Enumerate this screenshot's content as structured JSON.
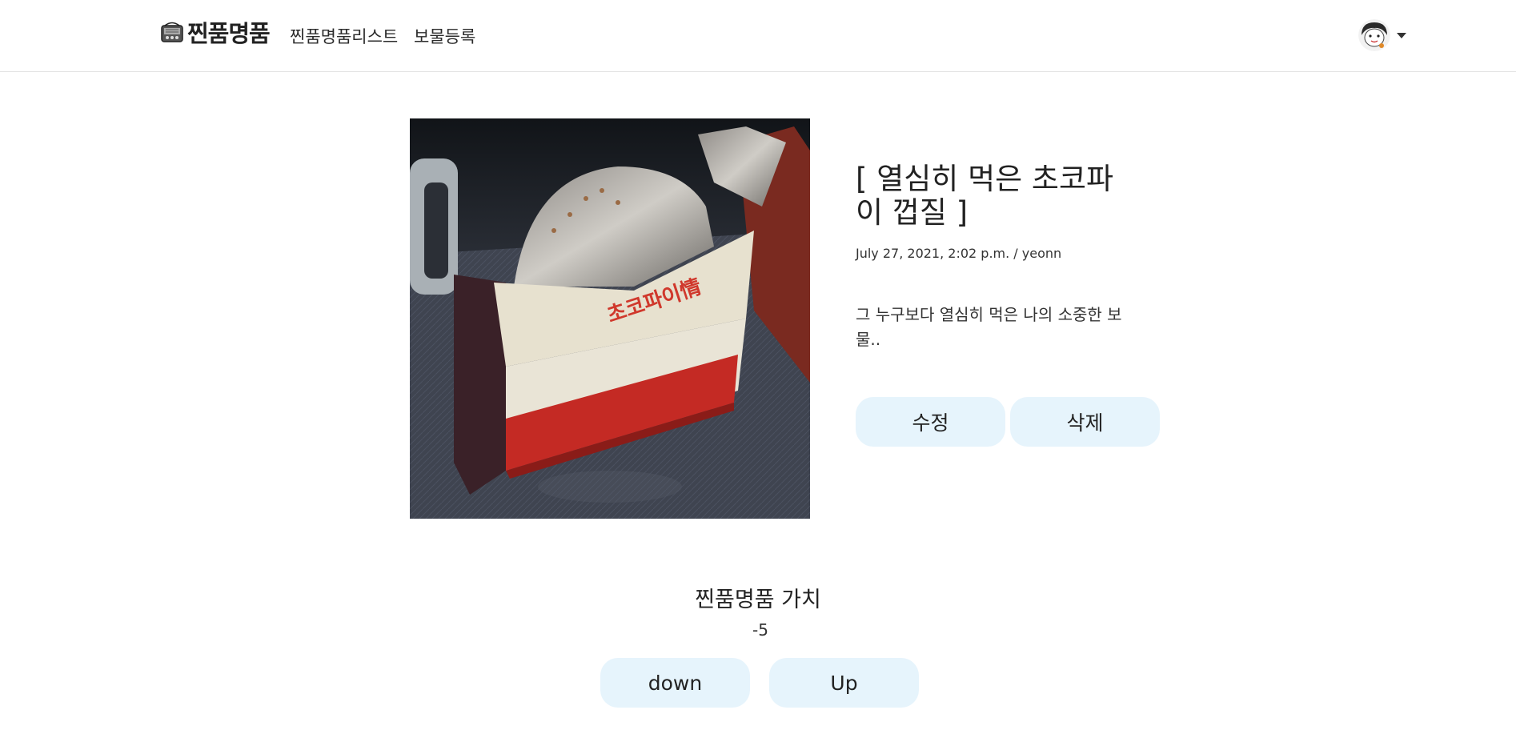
{
  "navbar": {
    "brand": "찐품명품",
    "links": [
      "찐품명품리스트",
      "보물등록"
    ]
  },
  "item": {
    "title": "[ 열심히 먹은 초코파이 껍질 ]",
    "meta": "July 27, 2021, 2:02 p.m. / yeonn",
    "description": "그 누구보다 열심히 먹은 나의 소중한 보물..",
    "edit_label": "수정",
    "delete_label": "삭제"
  },
  "value": {
    "title": "찐품명품 가치",
    "score": "-5",
    "down_label": "down",
    "up_label": "Up"
  },
  "colors": {
    "button_bg": "#e6f4fc",
    "border": "#e3e3e3"
  }
}
